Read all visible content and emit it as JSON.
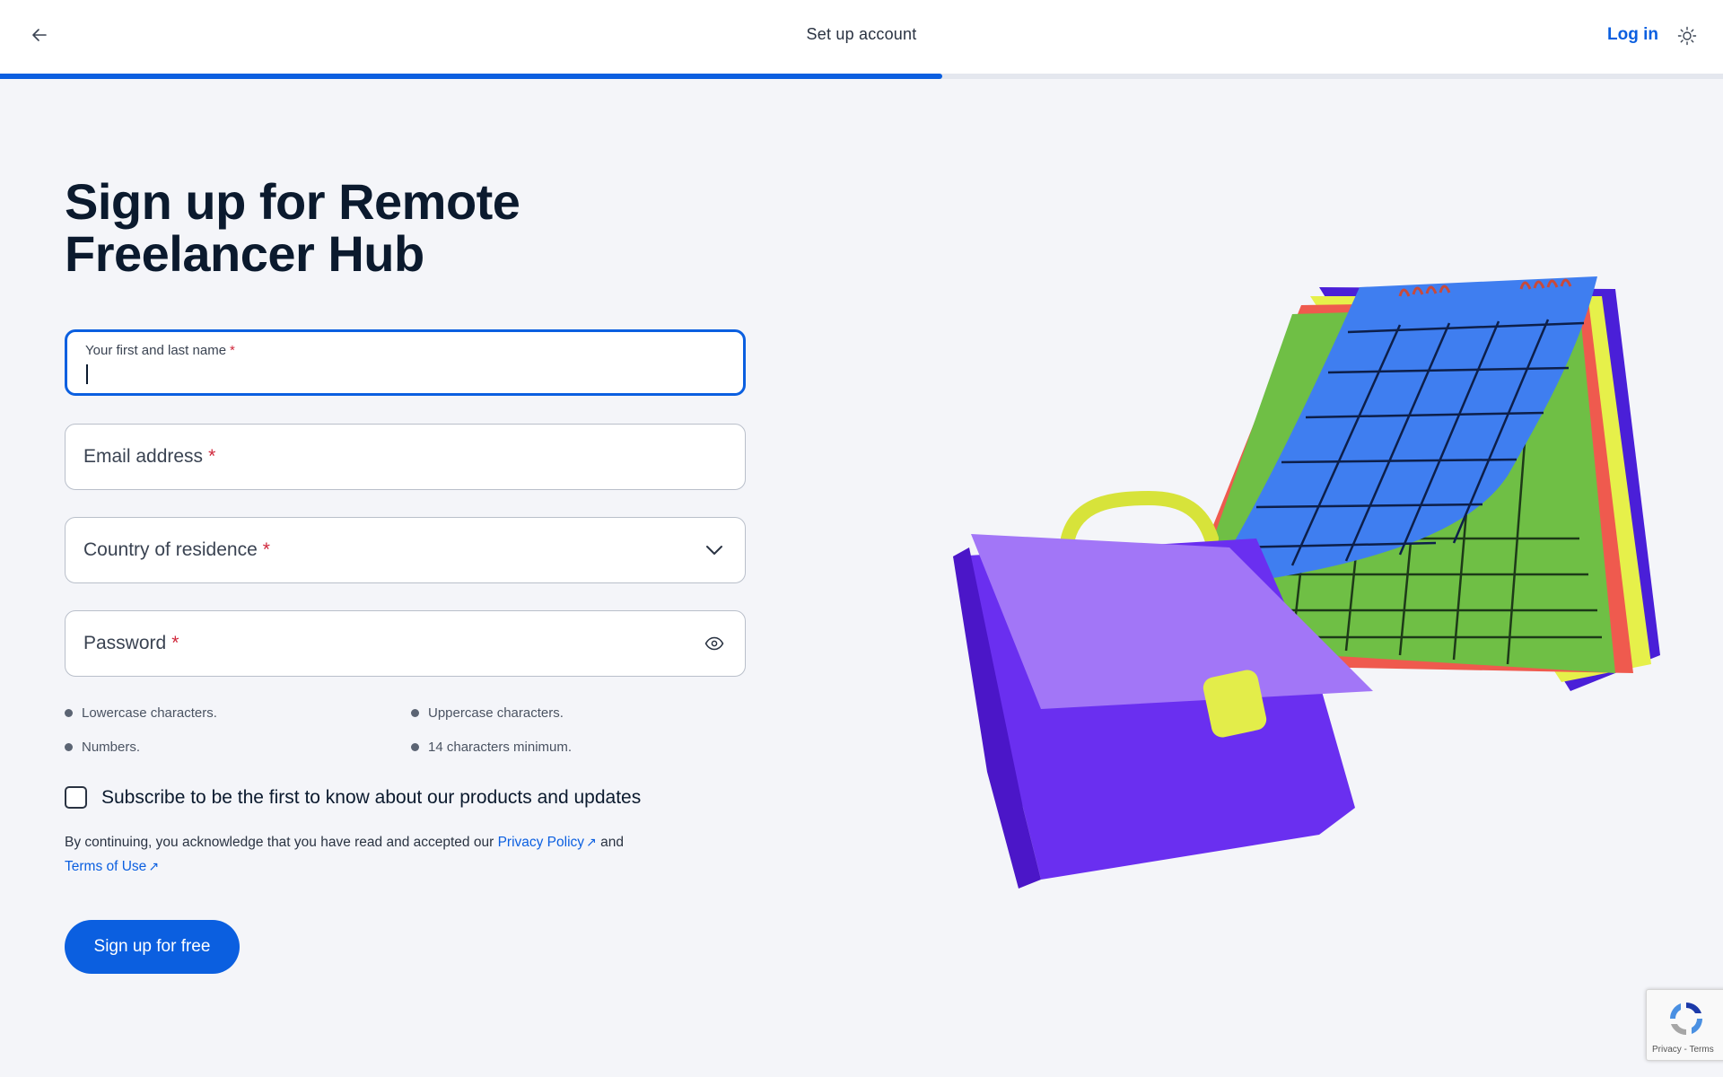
{
  "header": {
    "title": "Set up account",
    "login_label": "Log in",
    "icons": {
      "back": "arrow-left-icon",
      "theme": "sun-icon"
    }
  },
  "progress": {
    "fraction": 0.547,
    "color": "#0b5fe0"
  },
  "main": {
    "title": "Sign up for Remote Freelancer Hub",
    "fields": {
      "name": {
        "label": "Your first and last name",
        "required_mark": "*",
        "value": ""
      },
      "email": {
        "placeholder": "Email address",
        "required_mark": "*"
      },
      "country": {
        "placeholder": "Country of residence",
        "required_mark": "*"
      },
      "password": {
        "placeholder": "Password",
        "required_mark": "*"
      }
    },
    "password_rules": [
      "Lowercase characters.",
      "Uppercase characters.",
      "Numbers.",
      "14 characters minimum."
    ],
    "subscribe_label": "Subscribe to be the first to know about our products and updates",
    "subscribe_checked": false,
    "legal": {
      "prefix": "By continuing, you acknowledge that you have read and accepted our",
      "privacy_link": "Privacy Policy",
      "and": "and",
      "terms_link": "Terms of Use",
      "ext_icon": "↗"
    },
    "submit_label": "Sign up for free"
  },
  "recaptcha": {
    "links": "Privacy - Terms"
  },
  "colors": {
    "accent": "#0b5fe0",
    "required": "#d0283c",
    "background": "#f4f5f9"
  }
}
